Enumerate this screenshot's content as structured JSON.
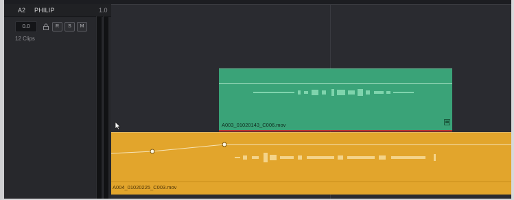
{
  "track": {
    "id": "A2",
    "name": "PHILIP",
    "volume": "1.0",
    "number_field": "0.0",
    "buttons": {
      "record": "R",
      "solo": "S",
      "mute": "M"
    },
    "clip_count": "12 Clips"
  },
  "clips": {
    "upper": {
      "name": "A003_01020143_C006.mov",
      "color": "#3aa378"
    },
    "lower": {
      "name": "A004_01020225_C003.mov",
      "color": "#e2a52c"
    }
  },
  "icons": {
    "lock": "lock-icon",
    "flag": "flag-icon",
    "cursor": "mouse-cursor-icon"
  }
}
